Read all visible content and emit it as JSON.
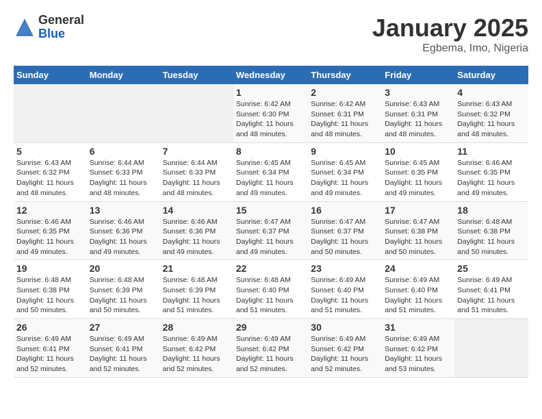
{
  "logo": {
    "general": "General",
    "blue": "Blue"
  },
  "title": "January 2025",
  "subtitle": "Egbema, Imo, Nigeria",
  "weekdays": [
    "Sunday",
    "Monday",
    "Tuesday",
    "Wednesday",
    "Thursday",
    "Friday",
    "Saturday"
  ],
  "weeks": [
    [
      null,
      null,
      null,
      {
        "day": "1",
        "sunrise": "Sunrise: 6:42 AM",
        "sunset": "Sunset: 6:30 PM",
        "daylight": "Daylight: 11 hours and 48 minutes."
      },
      {
        "day": "2",
        "sunrise": "Sunrise: 6:42 AM",
        "sunset": "Sunset: 6:31 PM",
        "daylight": "Daylight: 11 hours and 48 minutes."
      },
      {
        "day": "3",
        "sunrise": "Sunrise: 6:43 AM",
        "sunset": "Sunset: 6:31 PM",
        "daylight": "Daylight: 11 hours and 48 minutes."
      },
      {
        "day": "4",
        "sunrise": "Sunrise: 6:43 AM",
        "sunset": "Sunset: 6:32 PM",
        "daylight": "Daylight: 11 hours and 48 minutes."
      }
    ],
    [
      {
        "day": "5",
        "sunrise": "Sunrise: 6:43 AM",
        "sunset": "Sunset: 6:32 PM",
        "daylight": "Daylight: 11 hours and 48 minutes."
      },
      {
        "day": "6",
        "sunrise": "Sunrise: 6:44 AM",
        "sunset": "Sunset: 6:33 PM",
        "daylight": "Daylight: 11 hours and 48 minutes."
      },
      {
        "day": "7",
        "sunrise": "Sunrise: 6:44 AM",
        "sunset": "Sunset: 6:33 PM",
        "daylight": "Daylight: 11 hours and 48 minutes."
      },
      {
        "day": "8",
        "sunrise": "Sunrise: 6:45 AM",
        "sunset": "Sunset: 6:34 PM",
        "daylight": "Daylight: 11 hours and 49 minutes."
      },
      {
        "day": "9",
        "sunrise": "Sunrise: 6:45 AM",
        "sunset": "Sunset: 6:34 PM",
        "daylight": "Daylight: 11 hours and 49 minutes."
      },
      {
        "day": "10",
        "sunrise": "Sunrise: 6:45 AM",
        "sunset": "Sunset: 6:35 PM",
        "daylight": "Daylight: 11 hours and 49 minutes."
      },
      {
        "day": "11",
        "sunrise": "Sunrise: 6:46 AM",
        "sunset": "Sunset: 6:35 PM",
        "daylight": "Daylight: 11 hours and 49 minutes."
      }
    ],
    [
      {
        "day": "12",
        "sunrise": "Sunrise: 6:46 AM",
        "sunset": "Sunset: 6:35 PM",
        "daylight": "Daylight: 11 hours and 49 minutes."
      },
      {
        "day": "13",
        "sunrise": "Sunrise: 6:46 AM",
        "sunset": "Sunset: 6:36 PM",
        "daylight": "Daylight: 11 hours and 49 minutes."
      },
      {
        "day": "14",
        "sunrise": "Sunrise: 6:46 AM",
        "sunset": "Sunset: 6:36 PM",
        "daylight": "Daylight: 11 hours and 49 minutes."
      },
      {
        "day": "15",
        "sunrise": "Sunrise: 6:47 AM",
        "sunset": "Sunset: 6:37 PM",
        "daylight": "Daylight: 11 hours and 49 minutes."
      },
      {
        "day": "16",
        "sunrise": "Sunrise: 6:47 AM",
        "sunset": "Sunset: 6:37 PM",
        "daylight": "Daylight: 11 hours and 50 minutes."
      },
      {
        "day": "17",
        "sunrise": "Sunrise: 6:47 AM",
        "sunset": "Sunset: 6:38 PM",
        "daylight": "Daylight: 11 hours and 50 minutes."
      },
      {
        "day": "18",
        "sunrise": "Sunrise: 6:48 AM",
        "sunset": "Sunset: 6:38 PM",
        "daylight": "Daylight: 11 hours and 50 minutes."
      }
    ],
    [
      {
        "day": "19",
        "sunrise": "Sunrise: 6:48 AM",
        "sunset": "Sunset: 6:38 PM",
        "daylight": "Daylight: 11 hours and 50 minutes."
      },
      {
        "day": "20",
        "sunrise": "Sunrise: 6:48 AM",
        "sunset": "Sunset: 6:39 PM",
        "daylight": "Daylight: 11 hours and 50 minutes."
      },
      {
        "day": "21",
        "sunrise": "Sunrise: 6:48 AM",
        "sunset": "Sunset: 6:39 PM",
        "daylight": "Daylight: 11 hours and 51 minutes."
      },
      {
        "day": "22",
        "sunrise": "Sunrise: 6:48 AM",
        "sunset": "Sunset: 6:40 PM",
        "daylight": "Daylight: 11 hours and 51 minutes."
      },
      {
        "day": "23",
        "sunrise": "Sunrise: 6:49 AM",
        "sunset": "Sunset: 6:40 PM",
        "daylight": "Daylight: 11 hours and 51 minutes."
      },
      {
        "day": "24",
        "sunrise": "Sunrise: 6:49 AM",
        "sunset": "Sunset: 6:40 PM",
        "daylight": "Daylight: 11 hours and 51 minutes."
      },
      {
        "day": "25",
        "sunrise": "Sunrise: 6:49 AM",
        "sunset": "Sunset: 6:41 PM",
        "daylight": "Daylight: 11 hours and 51 minutes."
      }
    ],
    [
      {
        "day": "26",
        "sunrise": "Sunrise: 6:49 AM",
        "sunset": "Sunset: 6:41 PM",
        "daylight": "Daylight: 11 hours and 52 minutes."
      },
      {
        "day": "27",
        "sunrise": "Sunrise: 6:49 AM",
        "sunset": "Sunset: 6:41 PM",
        "daylight": "Daylight: 11 hours and 52 minutes."
      },
      {
        "day": "28",
        "sunrise": "Sunrise: 6:49 AM",
        "sunset": "Sunset: 6:42 PM",
        "daylight": "Daylight: 11 hours and 52 minutes."
      },
      {
        "day": "29",
        "sunrise": "Sunrise: 6:49 AM",
        "sunset": "Sunset: 6:42 PM",
        "daylight": "Daylight: 11 hours and 52 minutes."
      },
      {
        "day": "30",
        "sunrise": "Sunrise: 6:49 AM",
        "sunset": "Sunset: 6:42 PM",
        "daylight": "Daylight: 11 hours and 52 minutes."
      },
      {
        "day": "31",
        "sunrise": "Sunrise: 6:49 AM",
        "sunset": "Sunset: 6:42 PM",
        "daylight": "Daylight: 11 hours and 53 minutes."
      },
      null
    ]
  ]
}
